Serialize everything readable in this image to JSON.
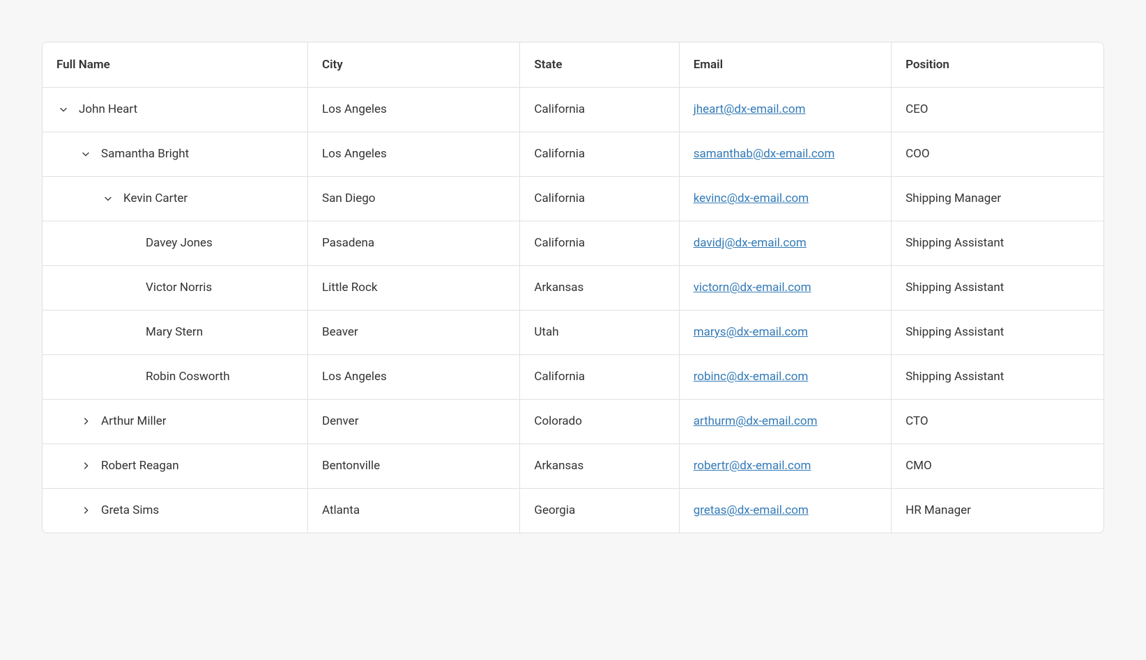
{
  "columns": [
    "Full Name",
    "City",
    "State",
    "Email",
    "Position"
  ],
  "rows": [
    {
      "level": 0,
      "expanded": true,
      "hasChildren": true,
      "name": "John Heart",
      "city": "Los Angeles",
      "state": "California",
      "email": "jheart@dx-email.com",
      "position": "CEO"
    },
    {
      "level": 1,
      "expanded": true,
      "hasChildren": true,
      "name": "Samantha Bright",
      "city": "Los Angeles",
      "state": "California",
      "email": "samanthab@dx-email.com",
      "position": "COO"
    },
    {
      "level": 2,
      "expanded": true,
      "hasChildren": true,
      "name": "Kevin Carter",
      "city": "San Diego",
      "state": "California",
      "email": "kevinc@dx-email.com",
      "position": "Shipping Manager"
    },
    {
      "level": 3,
      "expanded": false,
      "hasChildren": false,
      "name": "Davey Jones",
      "city": "Pasadena",
      "state": "California",
      "email": "davidj@dx-email.com",
      "position": "Shipping Assistant"
    },
    {
      "level": 3,
      "expanded": false,
      "hasChildren": false,
      "name": "Victor Norris",
      "city": "Little Rock",
      "state": "Arkansas",
      "email": "victorn@dx-email.com",
      "position": "Shipping Assistant"
    },
    {
      "level": 3,
      "expanded": false,
      "hasChildren": false,
      "name": "Mary Stern",
      "city": "Beaver",
      "state": "Utah",
      "email": "marys@dx-email.com",
      "position": "Shipping Assistant"
    },
    {
      "level": 3,
      "expanded": false,
      "hasChildren": false,
      "name": "Robin Cosworth",
      "city": "Los Angeles",
      "state": "California",
      "email": "robinc@dx-email.com",
      "position": "Shipping Assistant"
    },
    {
      "level": 1,
      "expanded": false,
      "hasChildren": true,
      "name": "Arthur Miller",
      "city": "Denver",
      "state": "Colorado",
      "email": "arthurm@dx-email.com",
      "position": "CTO"
    },
    {
      "level": 1,
      "expanded": false,
      "hasChildren": true,
      "name": "Robert Reagan",
      "city": "Bentonville",
      "state": "Arkansas",
      "email": "robertr@dx-email.com",
      "position": "CMO"
    },
    {
      "level": 1,
      "expanded": false,
      "hasChildren": true,
      "name": "Greta Sims",
      "city": "Atlanta",
      "state": "Georgia",
      "email": "gretas@dx-email.com",
      "position": "HR Manager"
    }
  ]
}
